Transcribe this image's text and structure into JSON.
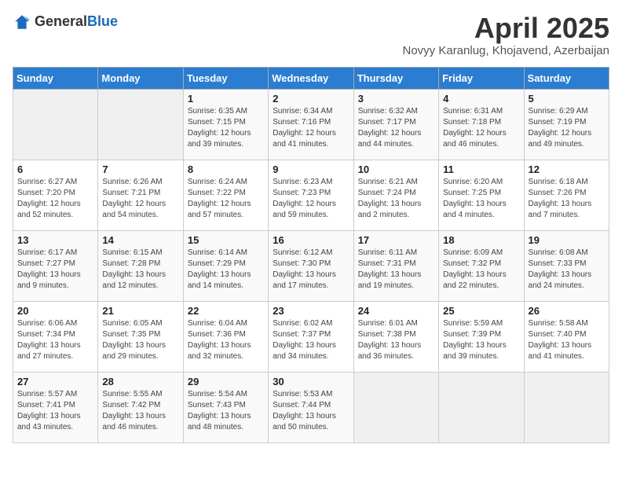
{
  "header": {
    "logo_general": "General",
    "logo_blue": "Blue",
    "title": "April 2025",
    "subtitle": "Novyy Karanlug, Khojavend, Azerbaijan"
  },
  "calendar": {
    "days_of_week": [
      "Sunday",
      "Monday",
      "Tuesday",
      "Wednesday",
      "Thursday",
      "Friday",
      "Saturday"
    ],
    "weeks": [
      [
        {
          "day": "",
          "info": ""
        },
        {
          "day": "",
          "info": ""
        },
        {
          "day": "1",
          "info": "Sunrise: 6:35 AM\nSunset: 7:15 PM\nDaylight: 12 hours and 39 minutes."
        },
        {
          "day": "2",
          "info": "Sunrise: 6:34 AM\nSunset: 7:16 PM\nDaylight: 12 hours and 41 minutes."
        },
        {
          "day": "3",
          "info": "Sunrise: 6:32 AM\nSunset: 7:17 PM\nDaylight: 12 hours and 44 minutes."
        },
        {
          "day": "4",
          "info": "Sunrise: 6:31 AM\nSunset: 7:18 PM\nDaylight: 12 hours and 46 minutes."
        },
        {
          "day": "5",
          "info": "Sunrise: 6:29 AM\nSunset: 7:19 PM\nDaylight: 12 hours and 49 minutes."
        }
      ],
      [
        {
          "day": "6",
          "info": "Sunrise: 6:27 AM\nSunset: 7:20 PM\nDaylight: 12 hours and 52 minutes."
        },
        {
          "day": "7",
          "info": "Sunrise: 6:26 AM\nSunset: 7:21 PM\nDaylight: 12 hours and 54 minutes."
        },
        {
          "day": "8",
          "info": "Sunrise: 6:24 AM\nSunset: 7:22 PM\nDaylight: 12 hours and 57 minutes."
        },
        {
          "day": "9",
          "info": "Sunrise: 6:23 AM\nSunset: 7:23 PM\nDaylight: 12 hours and 59 minutes."
        },
        {
          "day": "10",
          "info": "Sunrise: 6:21 AM\nSunset: 7:24 PM\nDaylight: 13 hours and 2 minutes."
        },
        {
          "day": "11",
          "info": "Sunrise: 6:20 AM\nSunset: 7:25 PM\nDaylight: 13 hours and 4 minutes."
        },
        {
          "day": "12",
          "info": "Sunrise: 6:18 AM\nSunset: 7:26 PM\nDaylight: 13 hours and 7 minutes."
        }
      ],
      [
        {
          "day": "13",
          "info": "Sunrise: 6:17 AM\nSunset: 7:27 PM\nDaylight: 13 hours and 9 minutes."
        },
        {
          "day": "14",
          "info": "Sunrise: 6:15 AM\nSunset: 7:28 PM\nDaylight: 13 hours and 12 minutes."
        },
        {
          "day": "15",
          "info": "Sunrise: 6:14 AM\nSunset: 7:29 PM\nDaylight: 13 hours and 14 minutes."
        },
        {
          "day": "16",
          "info": "Sunrise: 6:12 AM\nSunset: 7:30 PM\nDaylight: 13 hours and 17 minutes."
        },
        {
          "day": "17",
          "info": "Sunrise: 6:11 AM\nSunset: 7:31 PM\nDaylight: 13 hours and 19 minutes."
        },
        {
          "day": "18",
          "info": "Sunrise: 6:09 AM\nSunset: 7:32 PM\nDaylight: 13 hours and 22 minutes."
        },
        {
          "day": "19",
          "info": "Sunrise: 6:08 AM\nSunset: 7:33 PM\nDaylight: 13 hours and 24 minutes."
        }
      ],
      [
        {
          "day": "20",
          "info": "Sunrise: 6:06 AM\nSunset: 7:34 PM\nDaylight: 13 hours and 27 minutes."
        },
        {
          "day": "21",
          "info": "Sunrise: 6:05 AM\nSunset: 7:35 PM\nDaylight: 13 hours and 29 minutes."
        },
        {
          "day": "22",
          "info": "Sunrise: 6:04 AM\nSunset: 7:36 PM\nDaylight: 13 hours and 32 minutes."
        },
        {
          "day": "23",
          "info": "Sunrise: 6:02 AM\nSunset: 7:37 PM\nDaylight: 13 hours and 34 minutes."
        },
        {
          "day": "24",
          "info": "Sunrise: 6:01 AM\nSunset: 7:38 PM\nDaylight: 13 hours and 36 minutes."
        },
        {
          "day": "25",
          "info": "Sunrise: 5:59 AM\nSunset: 7:39 PM\nDaylight: 13 hours and 39 minutes."
        },
        {
          "day": "26",
          "info": "Sunrise: 5:58 AM\nSunset: 7:40 PM\nDaylight: 13 hours and 41 minutes."
        }
      ],
      [
        {
          "day": "27",
          "info": "Sunrise: 5:57 AM\nSunset: 7:41 PM\nDaylight: 13 hours and 43 minutes."
        },
        {
          "day": "28",
          "info": "Sunrise: 5:55 AM\nSunset: 7:42 PM\nDaylight: 13 hours and 46 minutes."
        },
        {
          "day": "29",
          "info": "Sunrise: 5:54 AM\nSunset: 7:43 PM\nDaylight: 13 hours and 48 minutes."
        },
        {
          "day": "30",
          "info": "Sunrise: 5:53 AM\nSunset: 7:44 PM\nDaylight: 13 hours and 50 minutes."
        },
        {
          "day": "",
          "info": ""
        },
        {
          "day": "",
          "info": ""
        },
        {
          "day": "",
          "info": ""
        }
      ]
    ]
  }
}
